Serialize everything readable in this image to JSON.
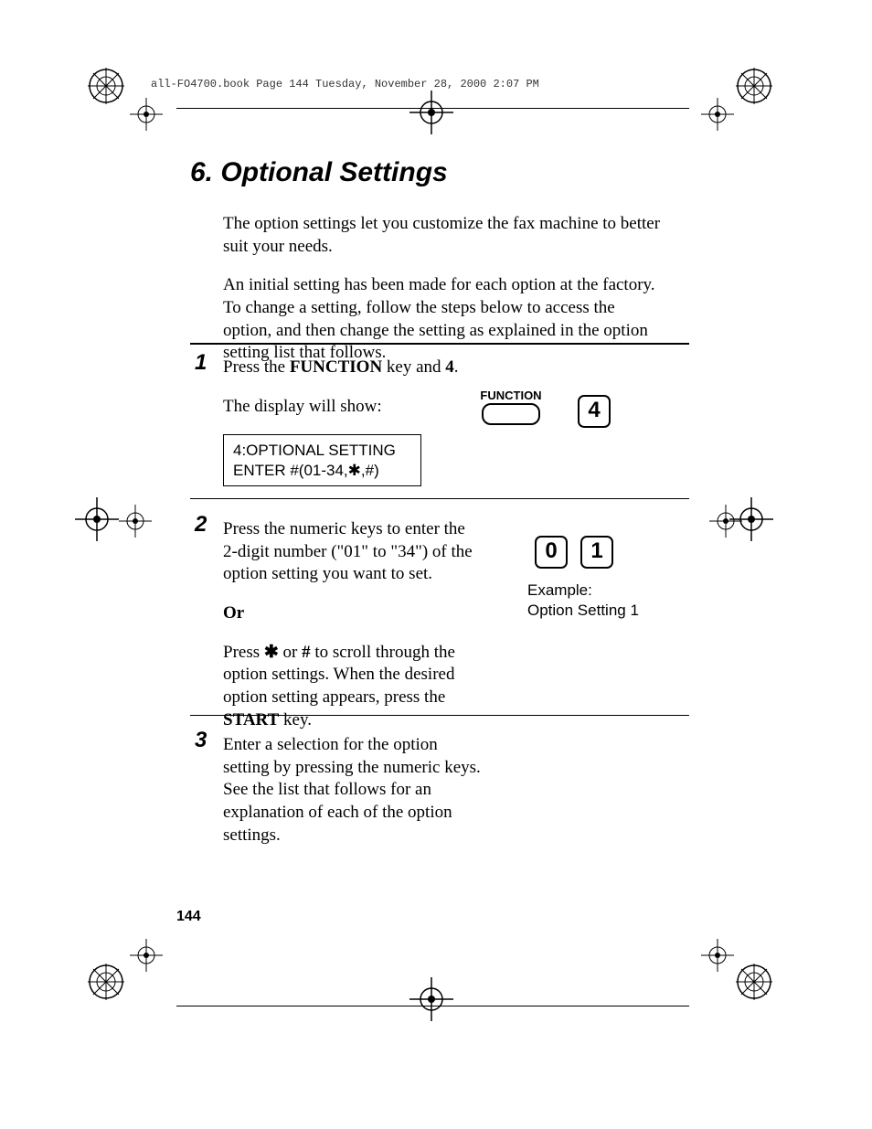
{
  "print_header": "all-FO4700.book  Page 144  Tuesday, November 28, 2000  2:07 PM",
  "chapter": {
    "number": "6.",
    "title": "Optional Settings"
  },
  "intro": {
    "p1": "The option settings let you customize the fax machine to better suit your needs.",
    "p2": "An initial setting has been made for each option at the factory. To change a setting, follow the steps below to access the option, and then change the setting as explained in the option setting list that follows."
  },
  "steps": {
    "s1": {
      "num": "1",
      "line1_a": "Press the ",
      "line1_b": "FUNCTION",
      "line1_c": " key and ",
      "line1_d": "4",
      "line1_e": ".",
      "line2": "The display will show:",
      "display_l1": "4:OPTIONAL SETTING",
      "display_l2": "ENTER #(01-34,✱,#)",
      "function_label": "FUNCTION",
      "key4": "4"
    },
    "s2": {
      "num": "2",
      "p1": "Press the numeric keys to enter the 2-digit number (\"01\" to \"34\") of the option setting you want to set.",
      "or": "Or",
      "p2_a": "Press ",
      "p2_star": "✱",
      "p2_b": " or ",
      "p2_hash": "#",
      "p2_c": " to scroll through the option settings. When the desired option setting appears, press the ",
      "p2_start": "START",
      "p2_d": " key.",
      "key0": "0",
      "key1": "1",
      "caption_l1": "Example:",
      "caption_l2": "Option Setting 1"
    },
    "s3": {
      "num": "3",
      "p1": "Enter a selection for the option setting by pressing the numeric keys. See the list that follows for an explanation of each of the option settings."
    }
  },
  "page_number": "144"
}
